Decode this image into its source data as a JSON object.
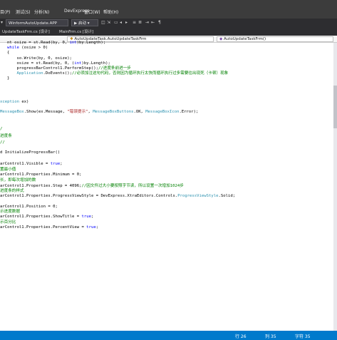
{
  "menu": [
    "目(P)",
    "测试(S)",
    "分析(N)",
    "DevExpress",
    "窗口(W)",
    "帮助(H)"
  ],
  "toolbar": {
    "project_select": "WinformAutoUpdate.APP",
    "start_label": "▶ 启动 ▾"
  },
  "tabs": [
    "UpdateTaskFrm.cs [设计]",
    "MainFrm.cs [设计]",
    "AutoUpdateTask.AutoUpdateTaskFrm",
    "AutoUpdateTaskFrm()"
  ],
  "code": {
    "l1": [
      [
        "",
        "nt osize = st.Read(by, 0, "
      ],
      [
        "kw",
        "int"
      ],
      [
        "",
        ")by.Length);"
      ]
    ],
    "l2": [
      [
        "kw",
        "while"
      ],
      [
        "",
        " (osize > 0)"
      ]
    ],
    "l3": [
      [
        "",
        "{"
      ]
    ],
    "l4": [
      [
        "",
        "    so.Write(by, 0, osize);"
      ]
    ],
    "l5": [
      [
        "",
        "    osize = st.Read(by, 0, ("
      ],
      [
        "kw",
        "int"
      ],
      [
        "",
        ")by.Length);"
      ]
    ],
    "l6": [
      [
        "",
        "    progressBarControl1.PerformStep();"
      ],
      [
        "cm",
        "//进度条前进一步"
      ]
    ],
    "l7": [
      [
        "",
        "    "
      ],
      [
        "ty",
        "Application"
      ],
      [
        "",
        ".DoEvents();"
      ],
      [
        "cm",
        "//必须加注这句代码，否则因为循环执行太快而循环执行过多需要往出现死（卡顿）现象"
      ]
    ],
    "l8": [
      [
        "",
        "}"
      ]
    ],
    "l9": [
      [
        "ty",
        "xception"
      ],
      [
        "",
        " ex)"
      ]
    ],
    "l10": [
      [
        "ty",
        "MessageBox"
      ],
      [
        "",
        ".Show(ex.Message, "
      ],
      [
        "st",
        "\"错误提示\""
      ],
      [
        "",
        ", "
      ],
      [
        "ty",
        "MessageBoxButtons"
      ],
      [
        "",
        ".OK, "
      ],
      [
        "ty",
        "MessageBoxIcon"
      ],
      [
        "",
        ".Error);"
      ]
    ],
    "l11": [
      [
        "cm",
        "/"
      ]
    ],
    "l12": [
      [
        "cm",
        "进度条"
      ]
    ],
    "l13": [
      [
        "cm",
        "//"
      ]
    ],
    "l14": [
      [
        "",
        "d InitializeProgressBar()"
      ]
    ],
    "l15": [
      [
        "",
        "arControl1.Visible = "
      ],
      [
        "kw",
        "true"
      ],
      [
        "",
        ";"
      ]
    ],
    "l16": [
      [
        "cm",
        "置最小值"
      ]
    ],
    "l17": [
      [
        "",
        "arControl1.Properties.Minimum = 0;"
      ]
    ],
    "l18": [
      [
        "cm",
        "长，即每次增加的数"
      ]
    ],
    "l19": [
      [
        "",
        "arControl1.Properties.Step = 4096;"
      ],
      [
        "cm",
        "//因文件过大小要按照字节读，所以设置一次增加1024步"
      ]
    ],
    "l20": [
      [
        "cm",
        "进度条的样式"
      ]
    ],
    "l21": [
      [
        "",
        "arControl1.Properties.ProgressViewStyle = DevExpress.XtraEditors.Controls."
      ],
      [
        "ty",
        "ProgressViewStyle"
      ],
      [
        "",
        ".Solid;"
      ]
    ],
    "l22": [
      [
        "",
        "arControl1.Position = 0;"
      ]
    ],
    "l23": [
      [
        "cm",
        "示进度数据"
      ]
    ],
    "l24": [
      [
        "",
        "arControl1.Properties.ShowTitle = "
      ],
      [
        "kw",
        "true"
      ],
      [
        "",
        ";"
      ]
    ],
    "l25": [
      [
        "cm",
        "示百分比"
      ]
    ],
    "l26": [
      [
        "",
        "arControl1.Properties.PercentView = "
      ],
      [
        "kw",
        "true"
      ],
      [
        "",
        ";"
      ]
    ]
  },
  "status": {
    "line": "行 26",
    "col": "列 35",
    "char": "字符 35"
  }
}
